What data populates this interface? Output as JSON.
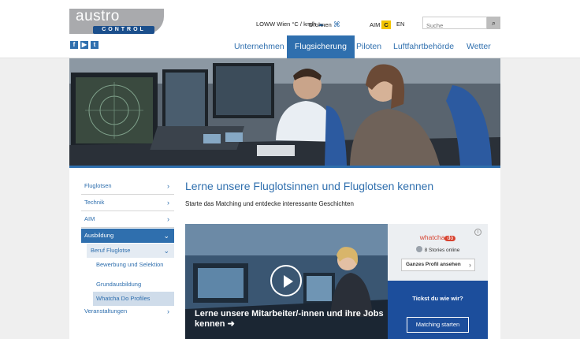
{
  "brand": {
    "word": "austro",
    "sub": "CONTROL"
  },
  "social": [
    {
      "icon": "facebook-icon",
      "glyph": "f"
    },
    {
      "icon": "youtube-icon",
      "glyph": "▶"
    },
    {
      "icon": "twitter-icon",
      "glyph": "t"
    }
  ],
  "utility": {
    "weather": "LOWW Wien  °C / km/h",
    "drohnen": "Drohnen",
    "aim": "AIM",
    "aim_badge": "C",
    "lang": "EN",
    "search_placeholder": "Suche",
    "search_icon": "search-icon"
  },
  "nav": [
    "Unternehmen",
    "Flugsicherung",
    "Piloten",
    "Luftfahrtbehörde",
    "Wetter"
  ],
  "nav_active": "Flugsicherung",
  "sidebar": {
    "items": [
      {
        "label": "Fluglotsen",
        "chev": "›"
      },
      {
        "label": "Technik",
        "chev": "›"
      },
      {
        "label": "AIM",
        "chev": "›"
      },
      {
        "label": "Ausbildung",
        "chev": "⌄"
      },
      {
        "label": "Beruf Fluglotse",
        "chev": "⌄"
      },
      {
        "label": "Bewerbung und Selektion"
      },
      {
        "label": "Grundausbildung"
      },
      {
        "label": "Whatcha Do Profiles"
      },
      {
        "label": "Veranstaltungen",
        "chev": "›"
      }
    ]
  },
  "main": {
    "title": "Lerne unsere Fluglotsinnen und Fluglotsen kennen",
    "subtitle": "Starte das Matching und entdecke interessante Geschichten"
  },
  "video": {
    "caption": "Lerne unsere Mitarbeiter/-innen und ihre Jobs kennen ➜"
  },
  "widget": {
    "logo_text": "whatcha",
    "logo_badge": "do",
    "info": "i",
    "stories": "8 Stories online",
    "profile_button": "Ganzes Profil ansehen",
    "profile_arrow": "›",
    "question": "Tickst du wie wir?",
    "match_button": "Matching starten"
  },
  "colors": {
    "brand_blue": "#2f6fae",
    "widget_blue": "#1c4e9c",
    "aim_yellow": "#f2c400",
    "whatcha_red": "#d7422f"
  }
}
